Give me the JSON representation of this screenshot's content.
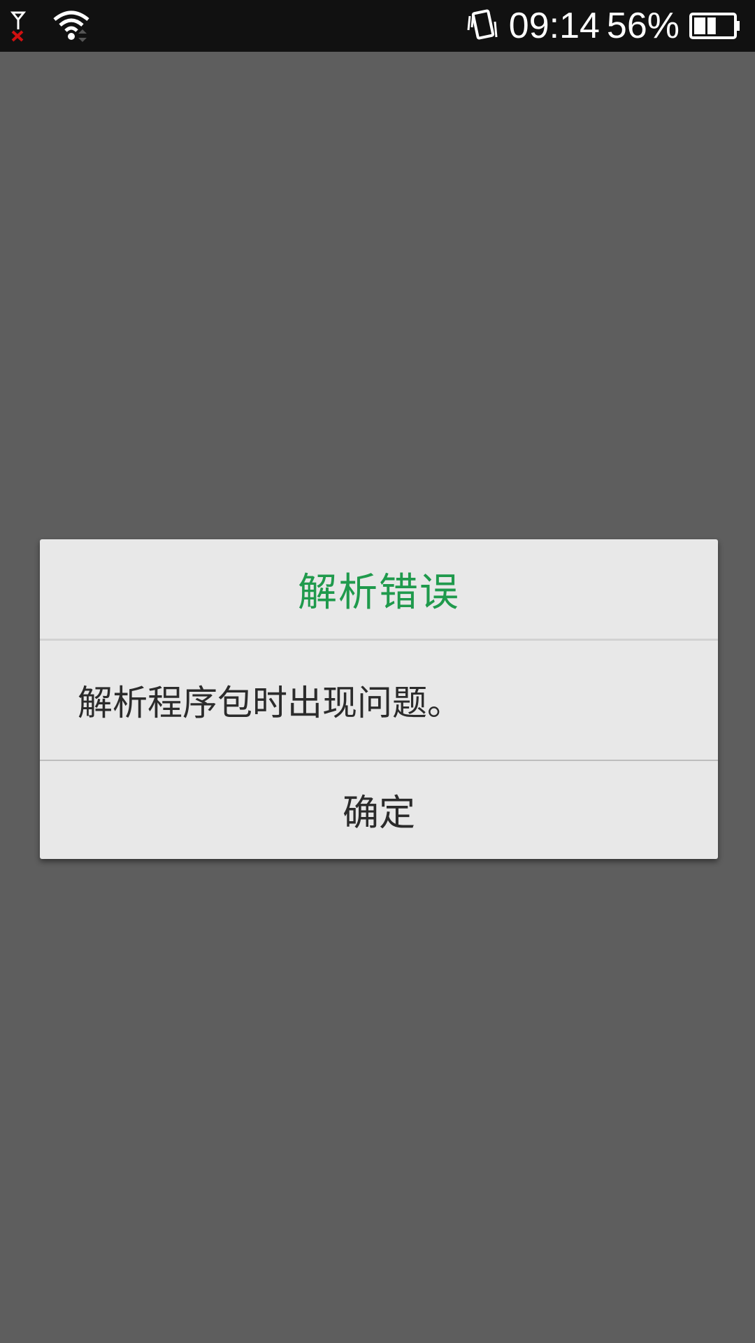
{
  "status_bar": {
    "time": "09:14",
    "battery_percent": "56%",
    "battery_level": 0.56,
    "icons": [
      "no-signal-icon",
      "wifi-icon",
      "vibrate-icon",
      "battery-icon"
    ]
  },
  "dialog": {
    "title": "解析错误",
    "message": "解析程序包时出现问题。",
    "ok_label": "确定",
    "title_color": "#1f9a4c"
  }
}
